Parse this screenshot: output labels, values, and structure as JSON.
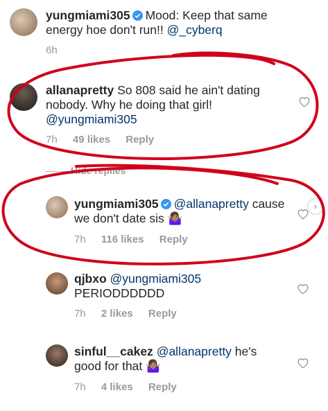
{
  "comments": [
    {
      "username": "yungmiami305",
      "verified": true,
      "text_before": "Mood: Keep that same energy hoe don't run!! ",
      "mention": "@_cyberq",
      "time": "6h"
    },
    {
      "username": "allanapretty",
      "verified": false,
      "text_before": "So 808 said he ain't dating nobody. Why he doing that girl! ",
      "mention": "@yungmiami305",
      "time": "7h",
      "likes": "49 likes",
      "reply_label": "Reply"
    },
    {
      "username": "yungmiami305",
      "verified": true,
      "mention": "@allanapretty",
      "text_after": " cause we don't date sis 🤷🏽‍♀️",
      "time": "7h",
      "likes": "116 likes",
      "reply_label": "Reply"
    },
    {
      "username": "qjbxo",
      "verified": false,
      "mention": "@yungmiami305",
      "text_after": " PERIODDDDDD",
      "time": "7h",
      "likes": "2 likes",
      "reply_label": "Reply"
    },
    {
      "username": "sinful__cakez",
      "verified": false,
      "mention": "@allanapretty",
      "text_after": " he's good for that 🤷🏽‍♀️",
      "time": "7h",
      "likes": "4 likes",
      "reply_label": "Reply"
    }
  ],
  "hide_replies_label": "Hide replies",
  "colors": {
    "text": "#262626",
    "mention": "#003569",
    "meta": "#999999",
    "annotation": "#d0021b",
    "verified": "#3897f0"
  }
}
